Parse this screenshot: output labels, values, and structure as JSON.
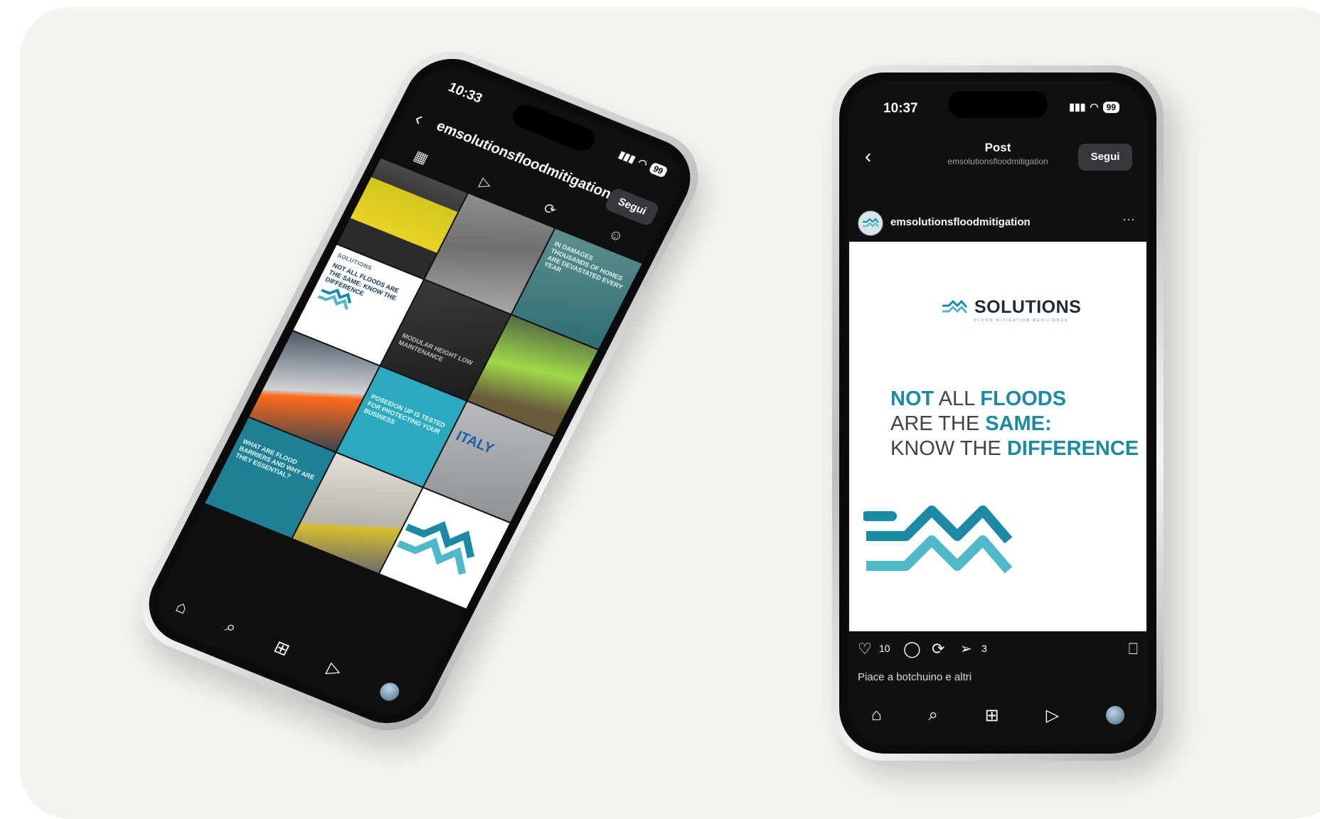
{
  "phone_left": {
    "status": {
      "time": "10:33",
      "battery": "99"
    },
    "header": {
      "username": "emsolutionsfloodmitigation",
      "follow_label": "Segui"
    },
    "tabs": [
      "grid-icon",
      "reels-icon",
      "reposts-icon",
      "tagged-icon"
    ],
    "tiles": {
      "sea_text": "IN DAMAGES THOUSANDS OF HOMES ARE DEVASTATED EVERY YEAR",
      "white_logo": "SOLUTIONS",
      "white_text": "NOT ALL FLOODS ARE THE SAME: KNOW THE DIFFERENCE",
      "dark_text": "MODULAR HEIGHT LOW MAINTENANCE",
      "teal_text": "POSEIDON UP IS TESTED FOR PROTECTING YOUR BUSINESS",
      "italy_text": "ITALY",
      "deep_text": "WHAT ARE FLOOD BARRIERS AND WHY ARE THEY ESSENTIAL?",
      "tile_logo": "SOLUTIONS"
    },
    "nav": [
      "home-icon",
      "search-icon",
      "add-icon",
      "reels-icon",
      "profile-avatar"
    ]
  },
  "phone_right": {
    "status": {
      "time": "10:37",
      "battery": "99"
    },
    "header": {
      "title": "Post",
      "subtitle": "emsolutionsfloodmitigation",
      "follow_label": "Segui"
    },
    "author": {
      "username": "emsolutionsfloodmitigation",
      "more": "···"
    },
    "post": {
      "brand": "SOLUTIONS",
      "tagline": "FLOOD MITIGATION RESILIENCE",
      "line1_a": "NOT",
      "line1_b": " ALL ",
      "line1_c": "FLOODS",
      "line2_a": "ARE THE ",
      "line2_b": "SAME:",
      "line3_a": "KNOW THE ",
      "line3_b": "DIFFERENCE"
    },
    "actions": {
      "likes_count": "10",
      "shares_count": "3"
    },
    "liked_by": "Piace a botchuino e altri",
    "caption_user": "emsolutionsfloodmitigation",
    "nav": [
      "home-icon",
      "search-icon",
      "add-icon",
      "reels-icon",
      "profile-avatar"
    ]
  },
  "colors": {
    "brand_teal": "#1c8aa3",
    "brand_light": "#4fb9c9",
    "brand_dark": "#1d2b36",
    "background": "#f4f3ee"
  }
}
